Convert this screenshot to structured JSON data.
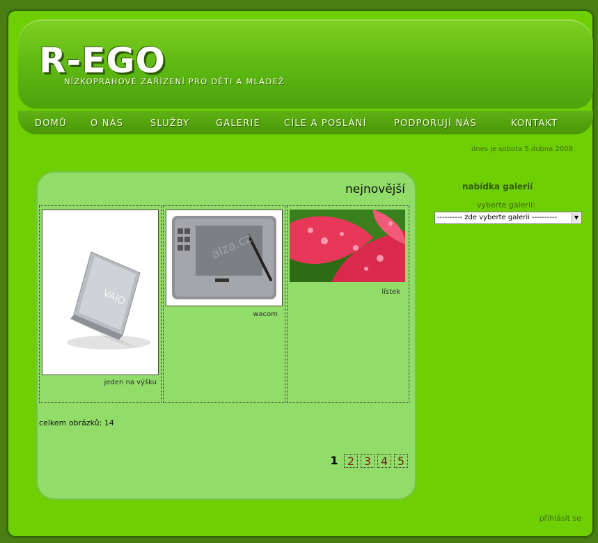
{
  "header": {
    "logo": "R-EGO",
    "tagline": "NÍZKOPRAHOVÉ ZAŘÍZENÍ PRO DĚTI A MLÁDEŽ"
  },
  "nav": {
    "items": [
      {
        "label": "DOMŮ"
      },
      {
        "label": "O NÁS"
      },
      {
        "label": "SLUŽBY"
      },
      {
        "label": "GALERIE"
      },
      {
        "label": "CÍLE A POSLÁNÍ"
      },
      {
        "label": "PODPORUJÍ NÁS"
      },
      {
        "label": "KONTAKT"
      }
    ]
  },
  "date_text": "dnes je sobota 5.dubna 2008",
  "gallery": {
    "title": "nejnovější",
    "items": [
      {
        "caption": "jeden na výšku"
      },
      {
        "caption": "wacom"
      },
      {
        "caption": "lístek"
      }
    ],
    "count_text": "celkem obrázků: 14",
    "pages": [
      "1",
      "2",
      "3",
      "4",
      "5"
    ]
  },
  "sidebar": {
    "title": "nabídka galerií",
    "label": "vyberte galerii:",
    "select_value": "---------- zde vyberte galerii ----------"
  },
  "footer": {
    "login": "přihlásit se"
  },
  "colors": {
    "page_bg": "#6fcf05",
    "panel_bg": "#92dd6a",
    "outer_bg": "#4a7d12"
  }
}
